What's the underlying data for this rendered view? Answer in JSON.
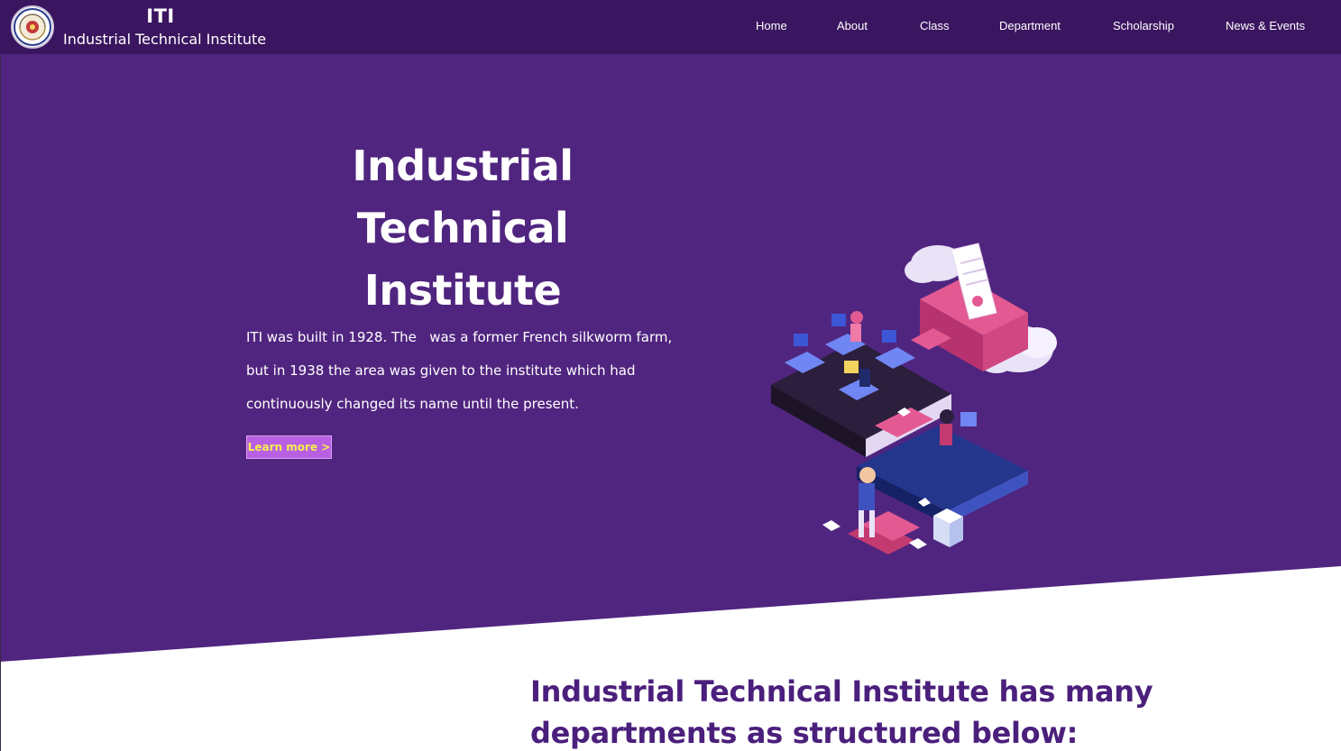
{
  "header": {
    "brand_short": "ITI",
    "brand_full": "Industrial Technical Institute",
    "logo_icon": "institute-seal-icon",
    "background": "#3b1660"
  },
  "nav": {
    "items": [
      {
        "label": "Home"
      },
      {
        "label": "About"
      },
      {
        "label": "Class"
      },
      {
        "label": "Department"
      },
      {
        "label": "Scholarship"
      },
      {
        "label": "News & Events"
      }
    ]
  },
  "hero": {
    "title_line1": "Industrial Technical",
    "title_line2": "Institute",
    "text_line1": "ITI was built in 1928. The   was a former French silkworm farm,",
    "text_line2": "but in 1938 the area was given to the institute which had",
    "text_line3": "continuously changed its name until the present.",
    "button_label": "Learn more >",
    "illustration_icon": "isometric-classroom-illustration",
    "background": "#50257f",
    "button_color": "#b95fe3",
    "button_text_color": "#f5ef4f"
  },
  "departments": {
    "heading_line1": "Industrial Technical Institute has many",
    "heading_line2": "departments as structured below:",
    "heading_color": "#4b1f7c"
  }
}
